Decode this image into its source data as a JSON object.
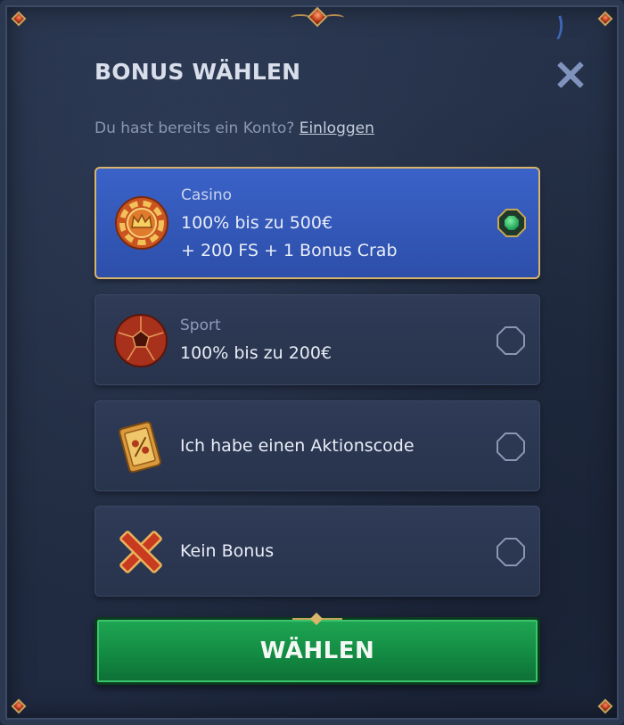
{
  "dialog": {
    "title": "BONUS WÄHLEN",
    "login_prompt": "Du hast bereits ein Konto?",
    "login_link": "Einloggen"
  },
  "options": [
    {
      "subtitle": "Casino",
      "line1": "100% bis zu 500€",
      "line2": "+ 200 FS + 1 Bonus Crab",
      "icon": "casino-chip-icon",
      "selected": true
    },
    {
      "subtitle": "Sport",
      "line1": "100% bis zu 200€",
      "icon": "soccer-ball-icon",
      "selected": false
    },
    {
      "line1": "Ich habe einen Aktionscode",
      "icon": "ticket-icon",
      "selected": false
    },
    {
      "line1": "Kein Bonus",
      "icon": "cross-icon",
      "selected": false
    }
  ],
  "submit_label": "WÄHLEN",
  "colors": {
    "selected_bg": "#3a62c8",
    "selected_border": "#d6b46c",
    "button_green": "#1fa653",
    "panel_bg": "#222d43"
  }
}
